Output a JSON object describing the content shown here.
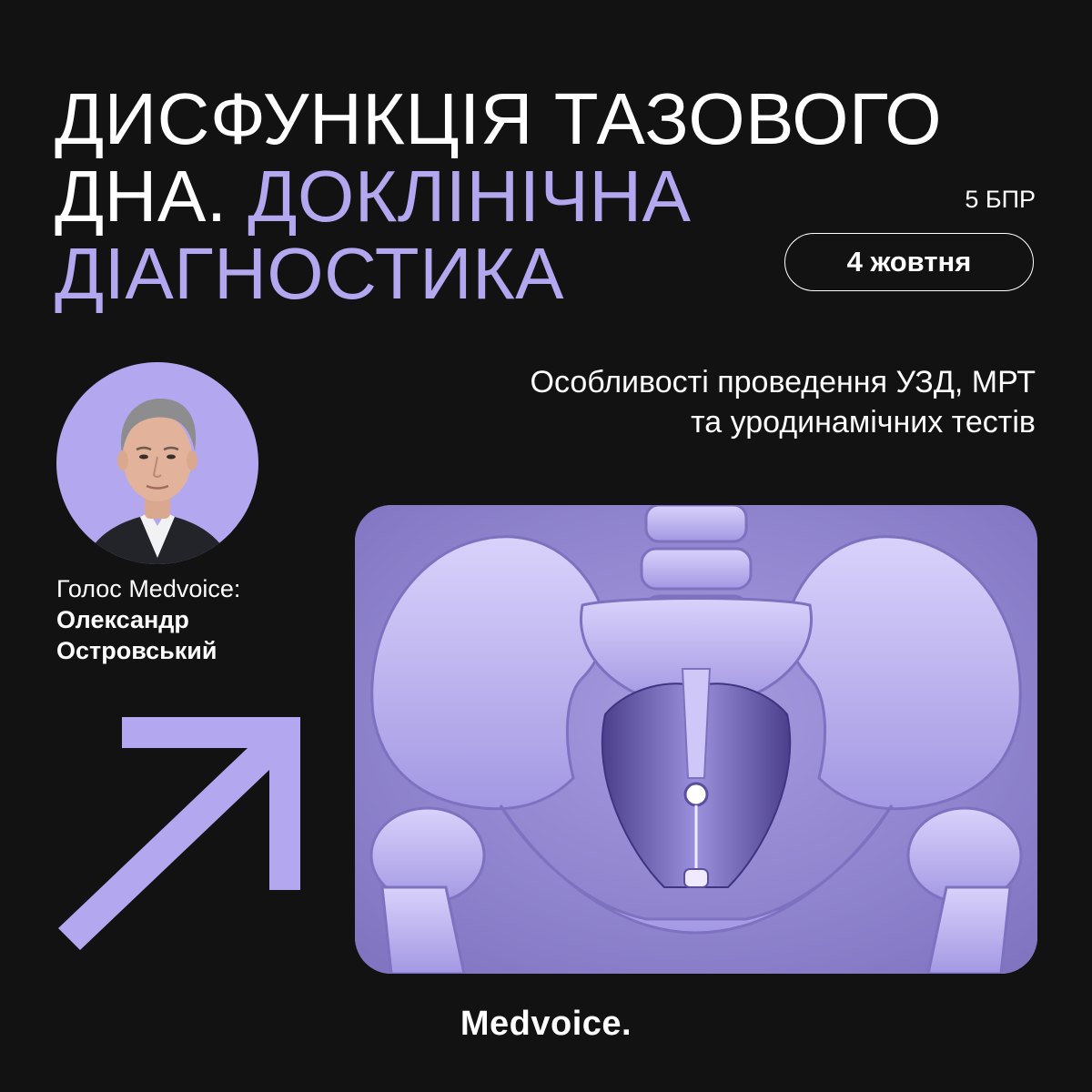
{
  "title": {
    "line1": "ДИСФУНКЦІЯ ТАЗОВОГО",
    "line2_white": "ДНА.",
    "line2_accent": "ДОКЛІНІЧНА",
    "line3_accent": "ДІАГНОСТИКА"
  },
  "credits": "5 БПР",
  "date": "4 жовтня",
  "subtitle": {
    "line1": "Особливості проведення УЗД, МРТ",
    "line2": "та уродинамічних тестів"
  },
  "speaker": {
    "prefix": "Голос Medvoice:",
    "first_name": "Олександр",
    "last_name": "Островський"
  },
  "logo": "Medvoice.",
  "colors": {
    "background": "#121212",
    "accent": "#b3a7ef",
    "text": "#ffffff",
    "image_tint": "#8f83cc"
  },
  "icons": {
    "arrow": "arrow-up-right-icon"
  }
}
